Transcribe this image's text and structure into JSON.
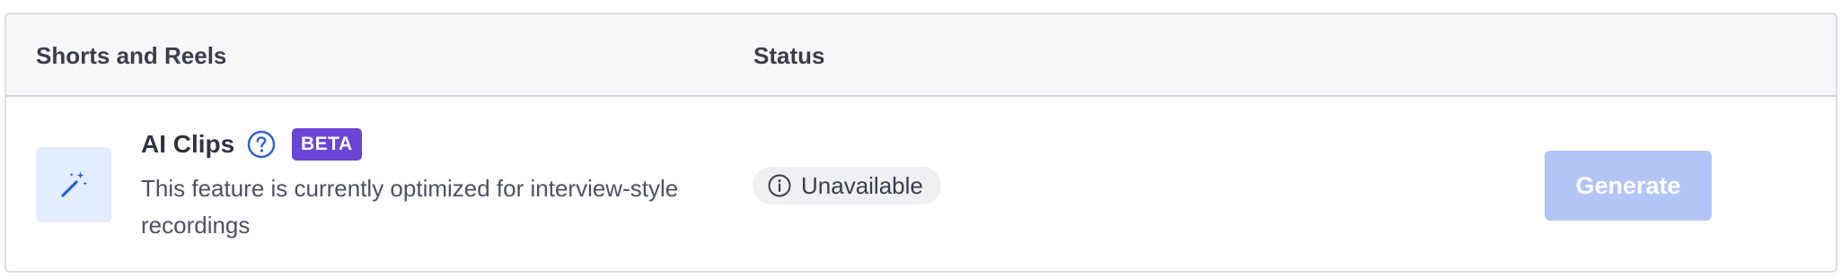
{
  "table": {
    "columns": {
      "name": "Shorts and Reels",
      "status": "Status"
    }
  },
  "feature": {
    "icon": "magic-wand-icon",
    "title": "AI Clips",
    "help_icon": "question-circle-icon",
    "badge": "BETA",
    "description": "This feature is currently optimized for interview-style recordings",
    "status_icon": "info-circle-icon",
    "status": "Unavailable",
    "action_label": "Generate",
    "action_enabled": false
  },
  "colors": {
    "accent": "#2f5fd0",
    "badge": "#6c45d6",
    "button_disabled": "#b3c5f6",
    "icon_bg": "#e4ecff"
  }
}
